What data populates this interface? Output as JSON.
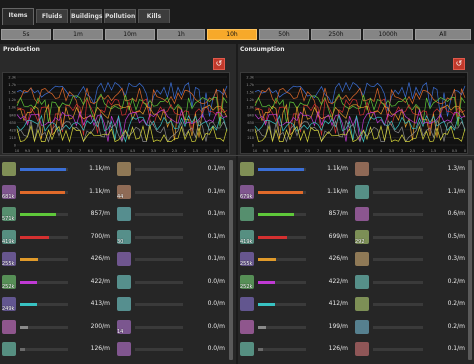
{
  "tabs": [
    "Items",
    "Fluids",
    "Buildings",
    "Pollution",
    "Kills"
  ],
  "time_buttons": [
    "5s",
    "1m",
    "10m",
    "1h",
    "10h",
    "50h",
    "250h",
    "1000h",
    "All"
  ],
  "selected_time": "10h",
  "production": {
    "title": "Production",
    "y_ticks": [
      "2.3k",
      "1.7k",
      "1.5k",
      "1.2k",
      "1.0k",
      "840",
      "630",
      "420",
      "210",
      "0"
    ],
    "x_ticks": [
      "10",
      "9.5",
      "9",
      "8.5",
      "8",
      "7.5",
      "7",
      "6.5",
      "6",
      "5.5",
      "5",
      "4.5",
      "4",
      "3.5",
      "3",
      "2.5",
      "2",
      "1.5",
      "1",
      "0.5",
      "0"
    ]
  },
  "consumption": {
    "title": "Consumption",
    "y_ticks": [
      "2.3k",
      "1.7k",
      "1.5k",
      "1.2k",
      "1.0k",
      "840",
      "630",
      "420",
      "210",
      "0"
    ],
    "x_ticks": [
      "10",
      "9.5",
      "9",
      "8.5",
      "8",
      "7.5",
      "7",
      "6.5",
      "6",
      "5.5",
      "5",
      "4.5",
      "4",
      "3.5",
      "3",
      "2.5",
      "2",
      "1.5",
      "1",
      "0.5",
      "0"
    ]
  },
  "colors": {
    "selected": "#f7a92a",
    "reset": "#c0392b"
  },
  "prod_left": [
    {
      "icon": "ore-icon",
      "count": "",
      "rate": "1.1k/m",
      "fill": 0.95,
      "color": "#3b6fd6"
    },
    {
      "icon": "plate-icon",
      "count": "681k",
      "rate": "1.1k/m",
      "fill": 0.93,
      "color": "#e06a2a"
    },
    {
      "icon": "circuit-icon",
      "count": "571k",
      "rate": "857/m",
      "fill": 0.74,
      "color": "#5fc83a"
    },
    {
      "icon": "gear-icon",
      "count": "419k",
      "rate": "700/m",
      "fill": 0.6,
      "color": "#d43030"
    },
    {
      "icon": "copper-plate-icon",
      "count": "255k",
      "rate": "426/m",
      "fill": 0.37,
      "color": "#e09a2a"
    },
    {
      "icon": "science-icon",
      "count": "252k",
      "rate": "422/m",
      "fill": 0.36,
      "color": "#c03ad4"
    },
    {
      "icon": "cable-icon",
      "count": "249k",
      "rate": "413/m",
      "fill": 0.35,
      "color": "#38c2c2"
    },
    {
      "icon": "stone-icon",
      "count": "",
      "rate": "200/m",
      "fill": 0.17,
      "color": "#8a8a8a"
    },
    {
      "icon": "coal-icon",
      "count": "",
      "rate": "126/m",
      "fill": 0.11,
      "color": "#6a6a6a"
    }
  ],
  "prod_right": [
    {
      "icon": "green-item-icon",
      "count": "",
      "rate": "0.1/m"
    },
    {
      "icon": "barrel-icon",
      "count": "44",
      "rate": "0.1/m"
    },
    {
      "icon": "red-item-icon",
      "count": "",
      "rate": "0.1/m"
    },
    {
      "icon": "rail-icon",
      "count": "30",
      "rate": "0.1/m"
    },
    {
      "icon": "inserter-icon",
      "count": "",
      "rate": "0.1/m"
    },
    {
      "icon": "lamp-icon",
      "count": "",
      "rate": "0.0/m"
    },
    {
      "icon": "pipe-icon",
      "count": "",
      "rate": "0.0/m"
    },
    {
      "icon": "flask-icon",
      "count": "14",
      "rate": "0.0/m"
    },
    {
      "icon": "drill-icon",
      "count": "",
      "rate": "0.0/m"
    }
  ],
  "cons_left": [
    {
      "icon": "ore-icon",
      "count": "",
      "rate": "1.1k/m",
      "fill": 0.95,
      "color": "#3b6fd6"
    },
    {
      "icon": "plate-icon",
      "count": "679k",
      "rate": "1.1k/m",
      "fill": 0.93,
      "color": "#e06a2a"
    },
    {
      "icon": "circuit-icon",
      "count": "",
      "rate": "857/m",
      "fill": 0.74,
      "color": "#5fc83a"
    },
    {
      "icon": "gear-icon",
      "count": "419k",
      "rate": "699/m",
      "fill": 0.6,
      "color": "#d43030"
    },
    {
      "icon": "copper-plate-icon",
      "count": "255k",
      "rate": "426/m",
      "fill": 0.37,
      "color": "#e09a2a"
    },
    {
      "icon": "science-icon",
      "count": "252k",
      "rate": "422/m",
      "fill": 0.36,
      "color": "#c03ad4"
    },
    {
      "icon": "cable-icon",
      "count": "",
      "rate": "412/m",
      "fill": 0.35,
      "color": "#38c2c2"
    },
    {
      "icon": "stone-icon",
      "count": "",
      "rate": "199/m",
      "fill": 0.17,
      "color": "#8a8a8a"
    },
    {
      "icon": "coal-icon",
      "count": "",
      "rate": "126/m",
      "fill": 0.11,
      "color": "#6a6a6a"
    }
  ],
  "cons_right": [
    {
      "icon": "engine-icon",
      "count": "",
      "rate": "1.3/m"
    },
    {
      "icon": "chip-icon",
      "count": "",
      "rate": "1.1/m"
    },
    {
      "icon": "armor-icon",
      "count": "",
      "rate": "0.6/m"
    },
    {
      "icon": "gun-icon",
      "count": "292",
      "rate": "0.5/m"
    },
    {
      "icon": "wrench-icon",
      "count": "",
      "rate": "0.3/m"
    },
    {
      "icon": "belt-icon",
      "count": "",
      "rate": "0.2/m"
    },
    {
      "icon": "box-icon",
      "count": "",
      "rate": "0.2/m"
    },
    {
      "icon": "tool-icon",
      "count": "",
      "rate": "0.2/m"
    },
    {
      "icon": "green-circuit-icon",
      "count": "",
      "rate": "0.1/m"
    }
  ]
}
